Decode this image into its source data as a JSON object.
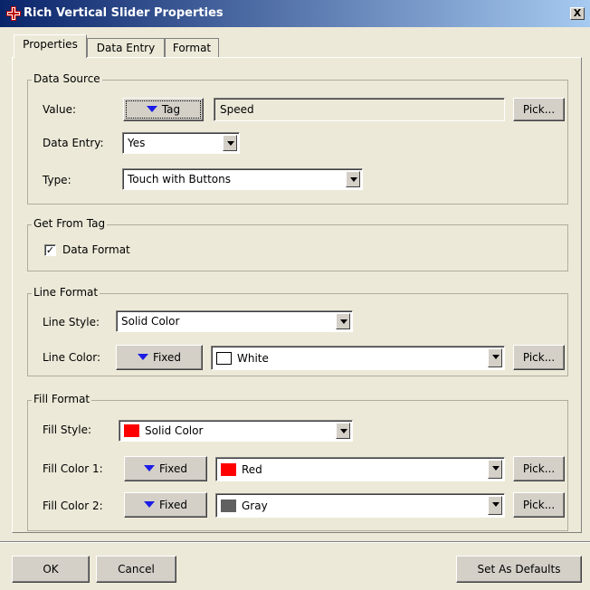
{
  "window": {
    "title": "Rich Vertical Slider Properties",
    "close_label": "X"
  },
  "tabs": [
    {
      "label": "Properties"
    },
    {
      "label": "Data Entry"
    },
    {
      "label": "Format"
    }
  ],
  "data_source": {
    "title": "Data Source",
    "value_label": "Value:",
    "value_mode": "Tag",
    "value_text": "Speed",
    "pick_label": "Pick...",
    "data_entry_label": "Data Entry:",
    "data_entry_value": "Yes",
    "type_label": "Type:",
    "type_value": "Touch with Buttons"
  },
  "get_from_tag": {
    "title": "Get From Tag",
    "data_format_label": "Data Format",
    "data_format_checked": true,
    "check_glyph": "✓"
  },
  "line_format": {
    "title": "Line Format",
    "style_label": "Line Style:",
    "style_value": "Solid Color",
    "color_label": "Line Color:",
    "color_mode": "Fixed",
    "color_value": "White",
    "color_hex": "#ffffff",
    "pick_label": "Pick..."
  },
  "fill_format": {
    "title": "Fill Format",
    "style_label": "Fill Style:",
    "style_value": "Solid Color",
    "style_swatch": "#ff0000",
    "color1_label": "Fill Color 1:",
    "color1_mode": "Fixed",
    "color1_value": "Red",
    "color1_hex": "#ff0000",
    "color2_label": "Fill Color 2:",
    "color2_mode": "Fixed",
    "color2_value": "Gray",
    "color2_hex": "#606060",
    "pick_label": "Pick..."
  },
  "footer": {
    "ok": "OK",
    "cancel": "Cancel",
    "defaults": "Set As Defaults"
  }
}
